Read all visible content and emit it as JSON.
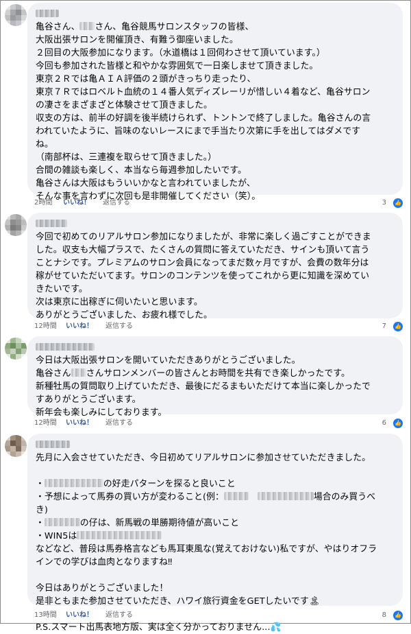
{
  "comments": [
    {
      "lines": [
        {
          "parts": [
            "亀谷さん、",
            {
              "mask": 22,
              "text": ""
            },
            "さん、亀谷競馬サロンスタッフの皆様、"
          ]
        },
        {
          "parts": [
            "大阪出張サロンを開催頂き、有難う御座いました。"
          ]
        },
        {
          "parts": [
            "２回目の大阪参加になります。（水道橋は１回伺わさせて頂いています。）"
          ]
        },
        {
          "parts": [
            "今回も参加された皆様と和やかな雰囲気で一日楽しませて頂きました。"
          ]
        },
        {
          "parts": [
            "東京２Ｒでは亀ＡＩＡ評価の２頭がきっちり走ったり、"
          ]
        },
        {
          "parts": [
            "東京７Ｒではロベルト血統の１４番人気ディズレーリが惜しい４着など、亀谷サロン"
          ]
        },
        {
          "parts": [
            "の凄さをまざまざと体験させて頂きました。"
          ]
        },
        {
          "parts": [
            "収支の方は、前半の好調を後半続けられず、トントンで終了しました。亀谷さんの言"
          ]
        },
        {
          "parts": [
            "われていたように、旨味のないレースにまで手当たり次第に手を出してはダメです"
          ]
        },
        {
          "parts": [
            "ね。"
          ]
        },
        {
          "parts": [
            "（南部杯は、三連複を取らせて頂きました。）"
          ]
        },
        {
          "parts": [
            "合間の雑談も楽しく、本当なら毎週参加したいです。"
          ]
        },
        {
          "parts": [
            "亀谷さんは大阪はもういいかなと言われていましたが、"
          ]
        },
        {
          "parts": [
            "そんな事を言わずに次回も是非開催してください（笑）。"
          ]
        }
      ],
      "time": "2時間",
      "like": "いいね！",
      "reply": "返信する",
      "count": "3"
    },
    {
      "lines": [
        {
          "parts": [
            "今回で初めてのリアルサロン参加になりましたが、非常に楽しく過ごすことができま"
          ]
        },
        {
          "parts": [
            "した。収支も大幅プラスで、たくさんの質問に答えていただき、サインも頂いて言う"
          ]
        },
        {
          "parts": [
            "ことナシです。プレミアムのサロン会員になってまだ数ヶ月ですが、会費の数年分は"
          ]
        },
        {
          "parts": [
            "稼がせていただいてます。サロンのコンテンツを使ってこれから更に知識を深めてい"
          ]
        },
        {
          "parts": [
            "きたいです。"
          ]
        },
        {
          "parts": [
            "次は東京に出稼ぎに伺いたいと思います。"
          ]
        },
        {
          "parts": [
            "ありがとうございました、お疲れ様でした。"
          ]
        }
      ],
      "time": "12時間",
      "like": "いいね！",
      "reply": "返信する",
      "count": "7"
    },
    {
      "lines": [
        {
          "parts": [
            "今日は大阪出張サロンを開いていただきありがとうございました。"
          ]
        },
        {
          "parts": [
            "亀谷さん",
            {
              "mask": 22,
              "text": ""
            },
            "さんサロンメンバーの皆さんとお時間を共有でき楽しかったです。"
          ]
        },
        {
          "parts": [
            "新種牡馬の質問取り上げていただき、最後にだるまもいただけて本当に楽しかったで"
          ]
        },
        {
          "parts": [
            "すありがとうございます。"
          ]
        },
        {
          "parts": [
            "新年会も楽しみにしております。"
          ]
        }
      ],
      "time": "12時間",
      "like": "いいね！",
      "reply": "返信する",
      "count": "6"
    },
    {
      "lines": [
        {
          "parts": [
            "先月に入会させていただき、今日初めてリアルサロンに参加させていただきました。"
          ]
        },
        {
          "blank": true
        },
        {
          "parts": [
            "・",
            {
              "mask": 86,
              "text": ""
            },
            "の好走パターンを探ると良いこと"
          ]
        },
        {
          "parts": [
            "・予想によって馬券の買い方が変わること(例：",
            {
              "mask": 36,
              "text": ""
            },
            "　",
            {
              "mask": 82,
              "text": ""
            },
            "場合のみ買うべ"
          ]
        },
        {
          "parts": [
            "き)"
          ]
        },
        {
          "parts": [
            "・",
            {
              "mask": 52,
              "text": ""
            },
            "の仔は、新馬戦の単勝期待値が高いこと"
          ]
        },
        {
          "parts": [
            "・WIN5は",
            {
              "mask": 124,
              "text": ""
            }
          ]
        },
        {
          "parts": [
            "などなど、普段は馬券格言なども馬耳東風な(覚えておけない)私ですが、やはりオフラ"
          ]
        },
        {
          "parts": [
            "インでの学びは血肉となりますね‼"
          ]
        },
        {
          "blank": true
        },
        {
          "parts": [
            "今日はありがとうございました！"
          ]
        },
        {
          "parts": [
            "是非ともまた参加させていただき、ハワイ旅行資金をGETしたいです🏝"
          ]
        },
        {
          "blank": true
        },
        {
          "parts": [
            "P.S.スマート出馬表地方版、実は全く分かっておりません...💦"
          ]
        }
      ],
      "time": "13時間",
      "like": "いいね！",
      "reply": "返信する",
      "count": "8"
    }
  ],
  "colors": {
    "bubble": "#f0f2f5",
    "like": "#385898",
    "meta": "#65676b",
    "reaction": "#1877f2"
  }
}
